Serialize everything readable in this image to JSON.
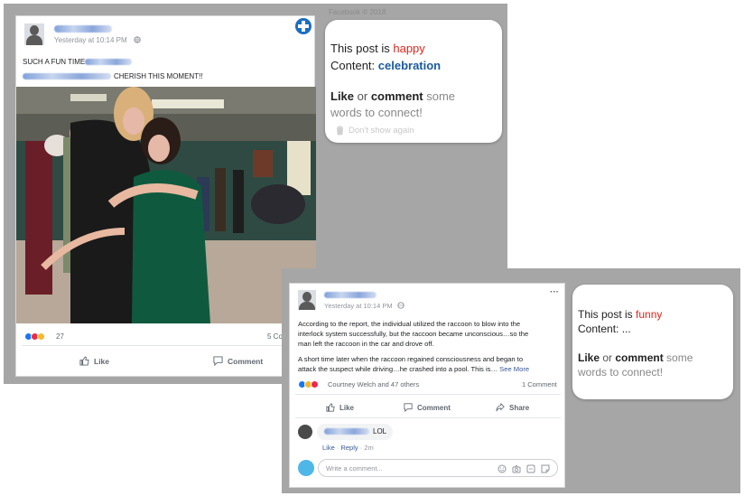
{
  "post1": {
    "timestamp": "Yesterday at 10:14 PM",
    "text_line1": "SUCH A FUN TIME",
    "text_line2": "CHERISH  THIS  MOMENT!!",
    "reaction_count": "27",
    "comments_count": "5 Co",
    "like_label": "Like",
    "comment_label": "Comment",
    "watermark": "Facebook © 2018"
  },
  "bubble1": {
    "line1_prefix": "This post is ",
    "sentiment": "happy",
    "line2_prefix": "Content: ",
    "content": "celebration",
    "like_word": "Like",
    "or_word": " or ",
    "comment_word": "comment",
    "rest1": " some",
    "rest2": "words to connect!",
    "dont_show": "Don't show again"
  },
  "post2": {
    "timestamp": "Yesterday at 10:14 PM",
    "para1_l1": "According to the report, the individual utilized the raccoon to blow into the",
    "para1_l2": "interlock system successfully, but the raccoon became unconscious…so the",
    "para1_l3": "man left the raccoon in the car and drove off.",
    "para2_l1": "A short time later when the raccoon regained consciousness and began to",
    "para2_l2": "attack the suspect while driving…he crashed into a pool. This is…",
    "see_more": " See More",
    "reactors": "Courtney Welch and 47 others",
    "comments_count": "1 Comment",
    "like_label": "Like",
    "comment_label": "Comment",
    "share_label": "Share",
    "comment_text": "LOL",
    "comment_like": "Like",
    "comment_reply": "Reply",
    "comment_time": "2m",
    "write_placeholder": "Write a comment..."
  },
  "bubble2": {
    "line1_prefix": "This post is ",
    "sentiment": "funny",
    "line2_prefix": "Content: ",
    "content": "...",
    "like_word": "Like",
    "or_word": " or ",
    "comment_word": "comment",
    "rest1": " some",
    "rest2": "words to connect!"
  },
  "colors": {
    "happy": "#e0261c",
    "funny": "#e0261c",
    "content_blue": "#1a5aa0",
    "fb_link": "#385898",
    "plus_button": "#1b6ec2"
  },
  "icons": [
    "plus-icon",
    "globe-icon",
    "like-icon",
    "comment-icon",
    "share-icon",
    "trash-icon",
    "more-icon",
    "emoji-icon",
    "camera-icon",
    "gif-icon",
    "sticker-icon"
  ]
}
